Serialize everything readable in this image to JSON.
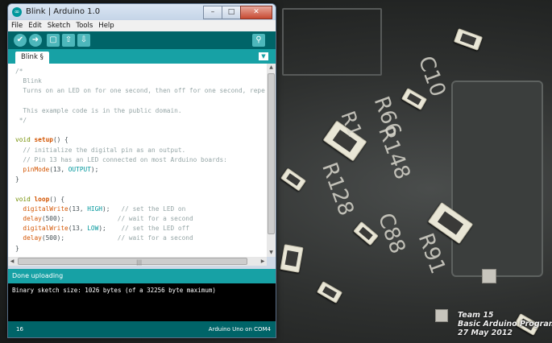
{
  "window": {
    "title": "Blink | Arduino 1.0",
    "controls": {
      "minimize": "–",
      "maximize": "□",
      "close": "✕"
    }
  },
  "menu": [
    "File",
    "Edit",
    "Sketch",
    "Tools",
    "Help"
  ],
  "toolbar": {
    "buttons": [
      {
        "name": "verify",
        "icon": "check-icon",
        "glyph": "✔"
      },
      {
        "name": "upload",
        "icon": "arrow-right-icon",
        "glyph": "➜"
      },
      {
        "name": "new",
        "icon": "new-file-icon",
        "glyph": "▢"
      },
      {
        "name": "open",
        "icon": "arrow-up-icon",
        "glyph": "⇧"
      },
      {
        "name": "save",
        "icon": "arrow-down-icon",
        "glyph": "⇩"
      }
    ],
    "serial_monitor": {
      "icon": "magnifier-icon",
      "glyph": "⚲"
    }
  },
  "tab": {
    "label": "Blink §",
    "menu_glyph": "▼"
  },
  "code_lines": [
    [
      {
        "t": "/*",
        "s": "c"
      }
    ],
    [
      {
        "t": "  Blink",
        "s": "c"
      }
    ],
    [
      {
        "t": "  Turns on an LED on for one second, then off for one second, repe",
        "s": "c"
      }
    ],
    [
      {
        "t": "",
        "s": "c"
      }
    ],
    [
      {
        "t": "  This example code is in the public domain.",
        "s": "c"
      }
    ],
    [
      {
        "t": " */",
        "s": "c"
      }
    ],
    [
      {
        "t": "",
        "s": ""
      }
    ],
    [
      {
        "t": "void ",
        "s": "k"
      },
      {
        "t": "setup",
        "s": "fb"
      },
      {
        "t": "() {",
        "s": ""
      }
    ],
    [
      {
        "t": "  // initialize the digital pin as an output.",
        "s": "c"
      }
    ],
    [
      {
        "t": "  // Pin 13 has an LED connected on most Arduino boards:",
        "s": "c"
      }
    ],
    [
      {
        "t": "  ",
        "s": ""
      },
      {
        "t": "pinMode",
        "s": "f"
      },
      {
        "t": "(13, ",
        "s": ""
      },
      {
        "t": "OUTPUT",
        "s": "kw"
      },
      {
        "t": ");",
        "s": ""
      }
    ],
    [
      {
        "t": "}",
        "s": ""
      }
    ],
    [
      {
        "t": "",
        "s": ""
      }
    ],
    [
      {
        "t": "void ",
        "s": "k"
      },
      {
        "t": "loop",
        "s": "fb"
      },
      {
        "t": "() {",
        "s": ""
      }
    ],
    [
      {
        "t": "  ",
        "s": ""
      },
      {
        "t": "digitalWrite",
        "s": "f"
      },
      {
        "t": "(13, ",
        "s": ""
      },
      {
        "t": "HIGH",
        "s": "kw"
      },
      {
        "t": ");   ",
        "s": ""
      },
      {
        "t": "// set the LED on",
        "s": "c"
      }
    ],
    [
      {
        "t": "  ",
        "s": ""
      },
      {
        "t": "delay",
        "s": "f"
      },
      {
        "t": "(500);              ",
        "s": ""
      },
      {
        "t": "// wait for a second",
        "s": "c"
      }
    ],
    [
      {
        "t": "  ",
        "s": ""
      },
      {
        "t": "digitalWrite",
        "s": "f"
      },
      {
        "t": "(13, ",
        "s": ""
      },
      {
        "t": "LOW",
        "s": "kw"
      },
      {
        "t": ");    ",
        "s": ""
      },
      {
        "t": "// set the LED off",
        "s": "c"
      }
    ],
    [
      {
        "t": "  ",
        "s": ""
      },
      {
        "t": "delay",
        "s": "f"
      },
      {
        "t": "(500);              ",
        "s": ""
      },
      {
        "t": "// wait for a second",
        "s": "c"
      }
    ],
    [
      {
        "t": "}",
        "s": ""
      }
    ]
  ],
  "status": {
    "message": "Done uploading"
  },
  "console": {
    "text": "Binary sketch size: 1026 bytes (of a 32256 byte maximum)"
  },
  "footer": {
    "line_number": "16",
    "board": "Arduino Uno on COM4"
  },
  "background_labels": [
    "C10",
    "R66",
    "R148",
    "R128",
    "C88",
    "R91",
    "R1"
  ],
  "credits": [
    "Team 15",
    "Basic Arduino Programming",
    "27 May 2012"
  ],
  "colors": {
    "teal_dark": "#006468",
    "teal": "#17a1a5",
    "button": "#4db7bb"
  }
}
